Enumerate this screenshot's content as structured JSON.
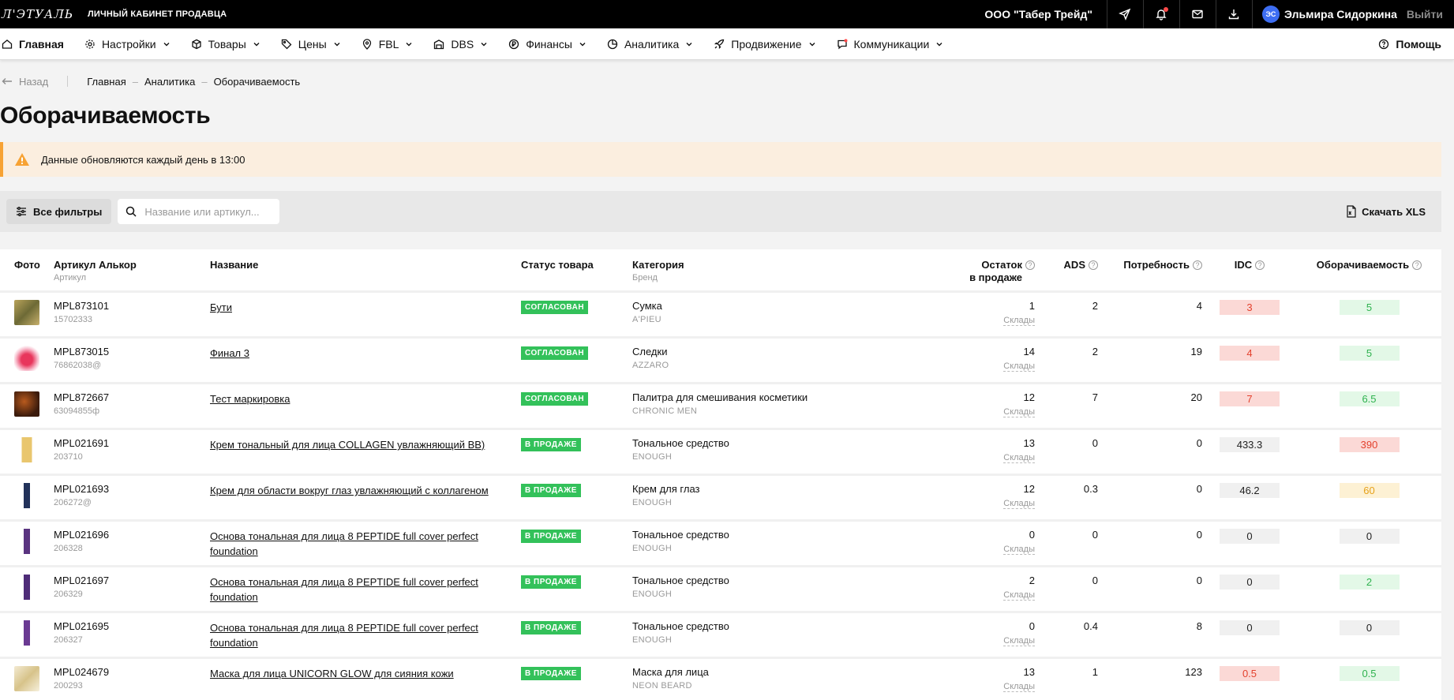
{
  "topbar": {
    "logo": "Л'ЭТУАЛЬ",
    "cabinet": "ЛИЧНЫЙ КАБИНЕТ ПРОДАВЦА",
    "company": "ООО \"Табер Трейд\"",
    "user_initials": "ЭС",
    "user_name": "Эльмира Сидоркина",
    "logout": "Выйти"
  },
  "nav": {
    "items": [
      {
        "label": "Главная"
      },
      {
        "label": "Настройки"
      },
      {
        "label": "Товары"
      },
      {
        "label": "Цены"
      },
      {
        "label": "FBL"
      },
      {
        "label": "DBS"
      },
      {
        "label": "Финансы"
      },
      {
        "label": "Аналитика"
      },
      {
        "label": "Продвижение"
      },
      {
        "label": "Коммуникации"
      }
    ],
    "help": "Помощь"
  },
  "breadcrumbs": {
    "back": "Назад",
    "items": [
      "Главная",
      "Аналитика",
      "Оборачиваемость"
    ]
  },
  "page_title": "Оборачиваемость",
  "alert_text": "Данные обновляются каждый день в 13:00",
  "filters": {
    "all_filters": "Все фильтры",
    "search_placeholder": "Название или артикул...",
    "download": "Скачать XLS"
  },
  "table": {
    "headers": {
      "photo": "Фото",
      "article": "Артикул Алькор",
      "article_sub": "Артикул",
      "name": "Название",
      "status": "Статус товара",
      "category": "Категория",
      "category_sub": "Бренд",
      "rest_line1": "Остаток",
      "rest_line2": "в продаже",
      "ads": "ADS",
      "need": "Потребность",
      "idc": "IDC",
      "turnover": "Оборачиваемость"
    },
    "warehouse_label": "Склады",
    "rows": [
      {
        "art": "MPL873101",
        "sku": "15702333",
        "name": "Бути",
        "status": "СОГЛАСОВАН",
        "category": "Сумка",
        "brand": "A'PIEU",
        "rest": "1",
        "ads": "2",
        "need": "4",
        "idc": "3",
        "idc_color": "red",
        "turn": "5",
        "turn_color": "green"
      },
      {
        "art": "MPL873015",
        "sku": "76862038@",
        "name": "Финал 3",
        "status": "СОГЛАСОВАН",
        "category": "Следки",
        "brand": "AZZARO",
        "rest": "14",
        "ads": "2",
        "need": "19",
        "idc": "4",
        "idc_color": "red",
        "turn": "5",
        "turn_color": "green"
      },
      {
        "art": "MPL872667",
        "sku": "63094855ф",
        "name": "Тест маркировка",
        "status": "СОГЛАСОВАН",
        "category": "Палитра для смешивания косметики",
        "brand": "CHRONIC MEN",
        "rest": "12",
        "ads": "7",
        "need": "20",
        "idc": "7",
        "idc_color": "red",
        "turn": "6.5",
        "turn_color": "green"
      },
      {
        "art": "MPL021691",
        "sku": "203710",
        "name": "Крем тональный для лица COLLAGEN увлажняющий BB)",
        "status": "В ПРОДАЖЕ",
        "category": "Тональное средство",
        "brand": "ENOUGH",
        "rest": "13",
        "ads": "0",
        "need": "0",
        "idc": "433.3",
        "idc_color": "gray",
        "turn": "390",
        "turn_color": "red"
      },
      {
        "art": "MPL021693",
        "sku": "206272@",
        "name": "Крем для области вокруг глаз увлажняющий с коллагеном",
        "status": "В ПРОДАЖЕ",
        "category": "Крем для глаз",
        "brand": "ENOUGH",
        "rest": "12",
        "ads": "0.3",
        "need": "0",
        "idc": "46.2",
        "idc_color": "gray",
        "turn": "60",
        "turn_color": "yellow"
      },
      {
        "art": "MPL021696",
        "sku": "206328",
        "name": "Основа тональная для лица 8 PEPTIDE full cover perfect foundation",
        "status": "В ПРОДАЖЕ",
        "category": "Тональное средство",
        "brand": "ENOUGH",
        "rest": "0",
        "ads": "0",
        "need": "0",
        "idc": "0",
        "idc_color": "gray",
        "turn": "0",
        "turn_color": "gray"
      },
      {
        "art": "MPL021697",
        "sku": "206329",
        "name": "Основа тональная для лица 8 PEPTIDE full cover perfect foundation",
        "status": "В ПРОДАЖЕ",
        "category": "Тональное средство",
        "brand": "ENOUGH",
        "rest": "2",
        "ads": "0",
        "need": "0",
        "idc": "0",
        "idc_color": "gray",
        "turn": "2",
        "turn_color": "green"
      },
      {
        "art": "MPL021695",
        "sku": "206327",
        "name": "Основа тональная для лица 8 PEPTIDE full cover perfect foundation",
        "status": "В ПРОДАЖЕ",
        "category": "Тональное средство",
        "brand": "ENOUGH",
        "rest": "0",
        "ads": "0.4",
        "need": "8",
        "idc": "0",
        "idc_color": "gray",
        "turn": "0",
        "turn_color": "gray"
      },
      {
        "art": "MPL024679",
        "sku": "200293",
        "name": "Маска для лица UNICORN GLOW для сияния кожи",
        "status": "В ПРОДАЖЕ",
        "category": "Маска для лица",
        "brand": "NEON BEARD",
        "rest": "13",
        "ads": "1",
        "need": "123",
        "idc": "0.5",
        "idc_color": "red",
        "turn": "0.5",
        "turn_color": "green"
      }
    ]
  },
  "colors": {
    "accent_green": "#33c15a",
    "alert_orange": "#f7a233",
    "avatar_blue": "#3d6df2"
  }
}
